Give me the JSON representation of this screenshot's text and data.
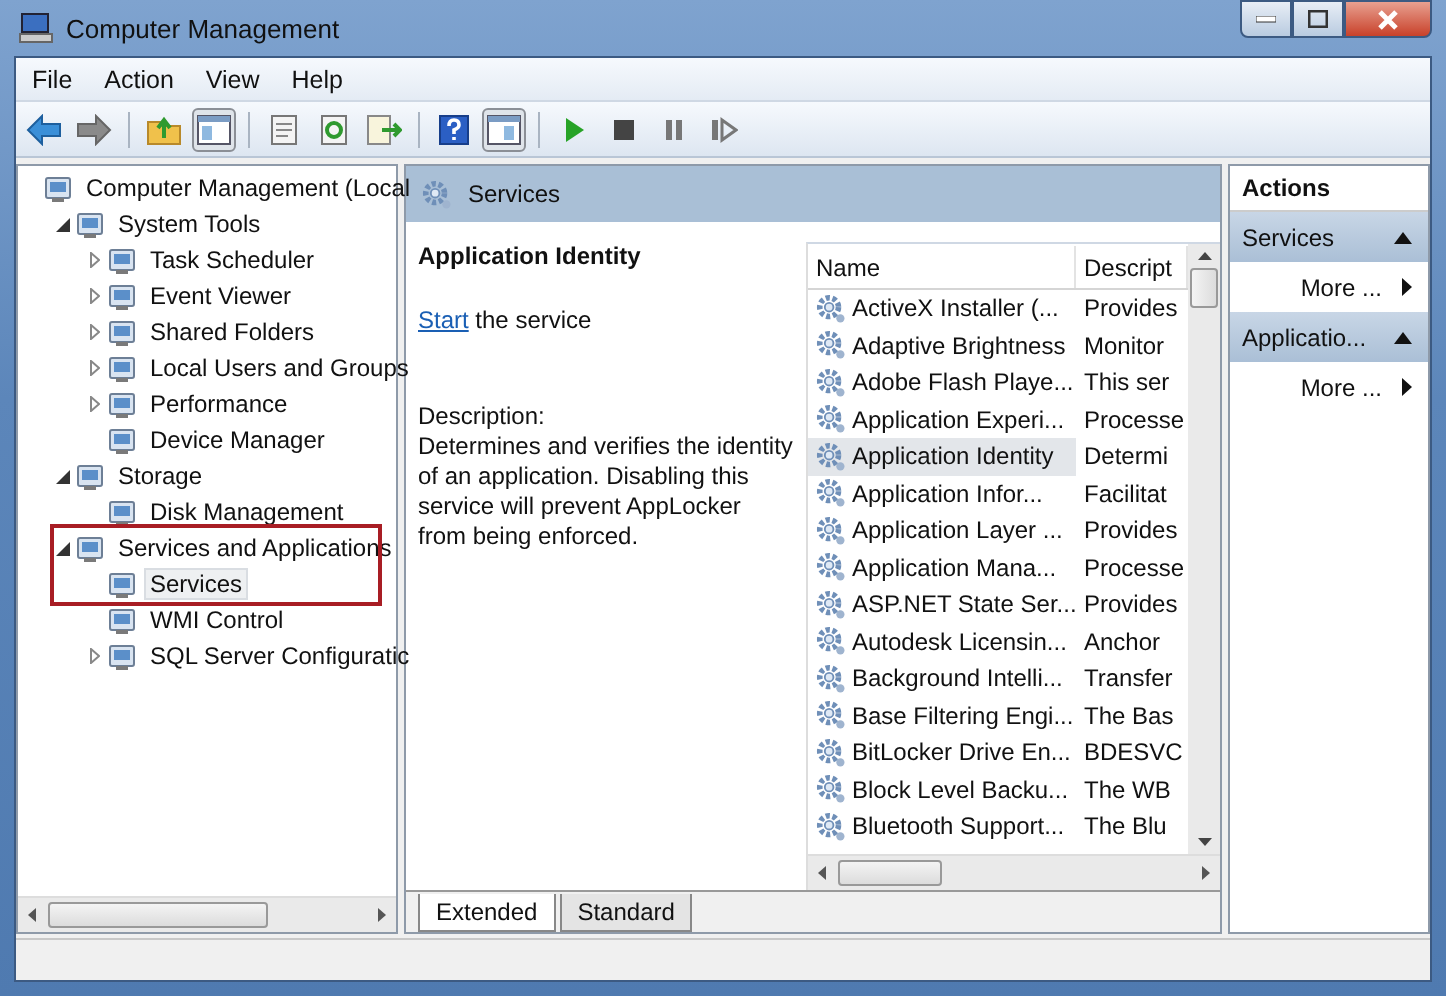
{
  "window": {
    "title": "Computer Management"
  },
  "menu": [
    "File",
    "Action",
    "View",
    "Help"
  ],
  "toolbar": [
    {
      "kind": "back",
      "pressed": false
    },
    {
      "kind": "forward",
      "pressed": false
    },
    {
      "kind": "sep",
      "pressed": false
    },
    {
      "kind": "up",
      "pressed": false
    },
    {
      "kind": "tree",
      "pressed": true
    },
    {
      "kind": "sep",
      "pressed": false
    },
    {
      "kind": "props",
      "pressed": false
    },
    {
      "kind": "refresh",
      "pressed": false
    },
    {
      "kind": "export",
      "pressed": false
    },
    {
      "kind": "sep",
      "pressed": false
    },
    {
      "kind": "help",
      "pressed": false
    },
    {
      "kind": "actionpane",
      "pressed": true
    },
    {
      "kind": "sep",
      "pressed": false
    },
    {
      "kind": "play",
      "pressed": false
    },
    {
      "kind": "stop",
      "pressed": false
    },
    {
      "kind": "pause",
      "pressed": false
    },
    {
      "kind": "resume",
      "pressed": false
    }
  ],
  "tree": [
    {
      "label": "Computer Management (Local",
      "selected": false,
      "children": [
        {
          "label": "System Tools",
          "expanded": true,
          "selected": false,
          "children": [
            {
              "label": "Task Scheduler",
              "expanded": false,
              "selected": false
            },
            {
              "label": "Event Viewer",
              "expanded": false,
              "selected": false
            },
            {
              "label": "Shared Folders",
              "expanded": false,
              "selected": false
            },
            {
              "label": "Local Users and Groups",
              "expanded": false,
              "selected": false
            },
            {
              "label": "Performance",
              "expanded": false,
              "selected": false
            },
            {
              "label": "Device Manager",
              "selected": false
            }
          ]
        },
        {
          "label": "Storage",
          "expanded": true,
          "selected": false,
          "children": [
            {
              "label": "Disk Management",
              "selected": false
            }
          ]
        },
        {
          "label": "Services and Applications",
          "expanded": true,
          "selected": false,
          "highlighted": true,
          "children": [
            {
              "label": "Services",
              "selected": true
            },
            {
              "label": "WMI Control",
              "selected": false
            },
            {
              "label": "SQL Server Configuratic",
              "expanded": false,
              "selected": false
            }
          ]
        }
      ]
    }
  ],
  "center": {
    "header": "Services",
    "detail": {
      "title": "Application Identity",
      "action_link": "Start",
      "action_text": " the service",
      "description_label": "Description:",
      "description": "Determines and verifies the identity of an application. Disabling this service will prevent AppLocker from being enforced."
    },
    "table": {
      "columns": [
        "Name",
        "Descript"
      ],
      "rows": [
        {
          "name": "ActiveX Installer (...",
          "description": "Provides",
          "selected": false
        },
        {
          "name": "Adaptive Brightness",
          "description": "Monitor",
          "selected": false
        },
        {
          "name": "Adobe Flash Playe...",
          "description": "This ser",
          "selected": false
        },
        {
          "name": "Application Experi...",
          "description": "Processe",
          "selected": false
        },
        {
          "name": "Application Identity",
          "description": "Determi",
          "selected": true
        },
        {
          "name": "Application Infor...",
          "description": "Facilitat",
          "selected": false
        },
        {
          "name": "Application Layer ...",
          "description": "Provides",
          "selected": false
        },
        {
          "name": "Application Mana...",
          "description": "Processe",
          "selected": false
        },
        {
          "name": "ASP.NET State Ser...",
          "description": "Provides",
          "selected": false
        },
        {
          "name": "Autodesk Licensin...",
          "description": "Anchor",
          "selected": false
        },
        {
          "name": "Background Intelli...",
          "description": "Transfer",
          "selected": false
        },
        {
          "name": "Base Filtering Engi...",
          "description": "The Bas",
          "selected": false
        },
        {
          "name": "BitLocker Drive En...",
          "description": "BDESVC",
          "selected": false
        },
        {
          "name": "Block Level Backu...",
          "description": "The WB",
          "selected": false
        },
        {
          "name": "Bluetooth Support...",
          "description": "The Blu",
          "selected": false
        }
      ]
    },
    "tabs": [
      {
        "label": "Extended",
        "selected": true
      },
      {
        "label": "Standard",
        "selected": false
      }
    ]
  },
  "actions": {
    "title": "Actions",
    "sections": [
      {
        "title": "Services",
        "expanded": true,
        "items": [
          "More ..."
        ]
      },
      {
        "title": "Applicatio...",
        "expanded": true,
        "items": [
          "More ..."
        ]
      }
    ]
  }
}
